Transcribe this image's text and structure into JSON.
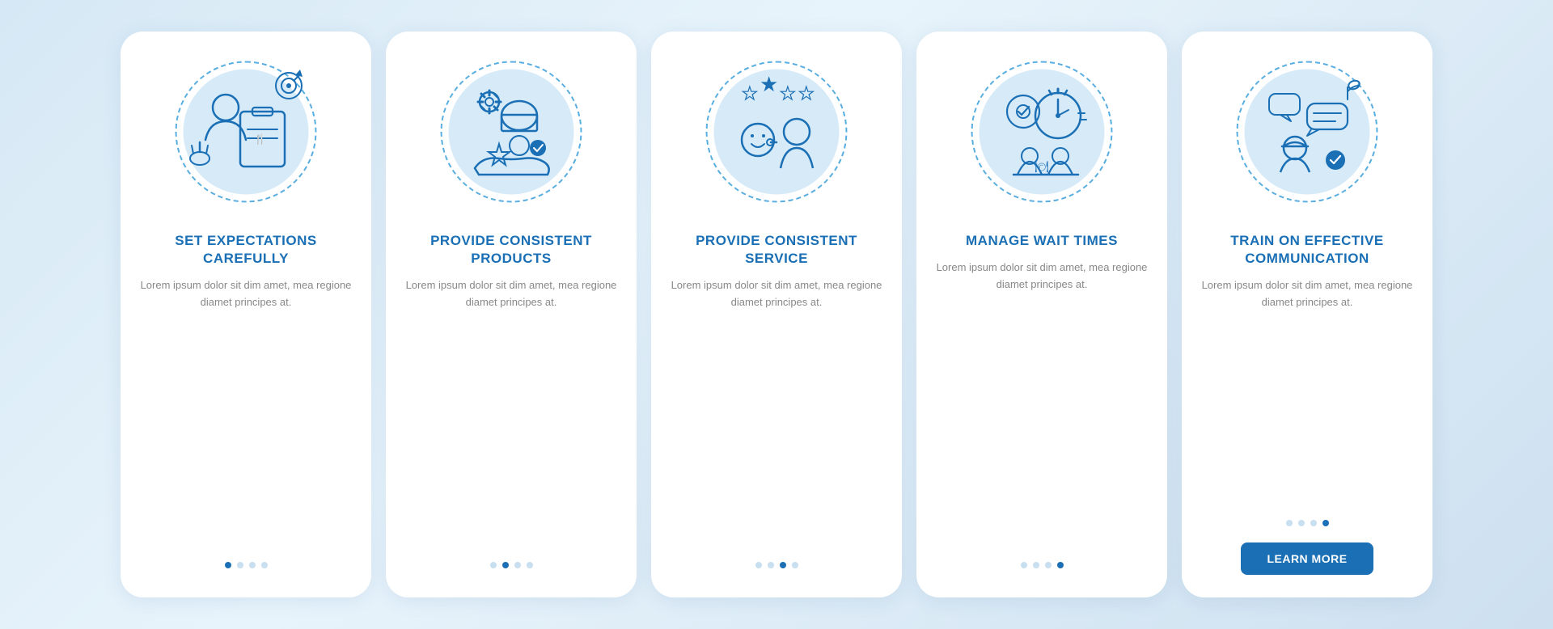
{
  "cards": [
    {
      "id": "card-1",
      "title": "SET EXPECTATIONS\nCAREFULLY",
      "text": "Lorem ipsum dolor sit dim amet, mea regione diamet principes at.",
      "dots": [
        true,
        false,
        false,
        false
      ],
      "active_dot": 0,
      "icon": "clipboard-person",
      "has_button": false
    },
    {
      "id": "card-2",
      "title": "PROVIDE\nCONSISTENT\nPRODUCTS",
      "text": "Lorem ipsum dolor sit dim amet, mea regione diamet principes at.",
      "dots": [
        false,
        true,
        false,
        false
      ],
      "active_dot": 1,
      "icon": "chef-star",
      "has_button": false
    },
    {
      "id": "card-3",
      "title": "PROVIDE\nCONSISTENT\nSERVICE",
      "text": "Lorem ipsum dolor sit dim amet, mea regione diamet principes at.",
      "dots": [
        false,
        false,
        true,
        false
      ],
      "active_dot": 2,
      "icon": "happy-waiter",
      "has_button": false
    },
    {
      "id": "card-4",
      "title": "MANAGE\nWAIT TIMES",
      "text": "Lorem ipsum dolor sit dim amet, mea regione diamet principes at.",
      "dots": [
        false,
        false,
        false,
        true
      ],
      "active_dot": 3,
      "icon": "timer-dining",
      "has_button": false
    },
    {
      "id": "card-5",
      "title": "TRAIN ON EFFECTIVE\nCOMMUNICATION",
      "text": "Lorem ipsum dolor sit dim amet, mea regione diamet principes at.",
      "dots": [
        false,
        false,
        false,
        true
      ],
      "active_dot": 3,
      "icon": "communication",
      "has_button": true,
      "button_label": "LEARN MORE"
    }
  ],
  "colors": {
    "accent": "#1a6fb5",
    "light_blue": "#d6eaf8",
    "dot_inactive": "#c8dff0",
    "text_muted": "#aaaaaa",
    "white": "#ffffff"
  }
}
